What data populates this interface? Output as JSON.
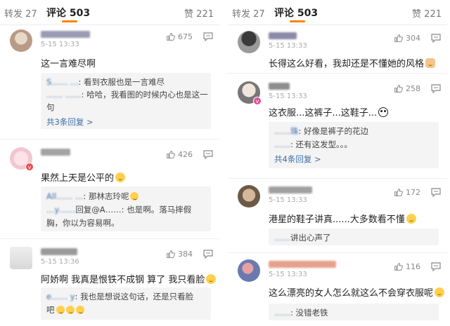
{
  "left": {
    "tabs": {
      "repost": "转发 27",
      "comments": "评论 503",
      "likes": "赞 221"
    },
    "comments": [
      {
        "time": "5-15 13:33",
        "likes": "675",
        "text": "这一言难尽啊",
        "replies": [
          {
            "name": "S…… …",
            "text": ": 看到衣服也是一言难尽"
          },
          {
            "name": "…… ……",
            "text": ": 哈哈，我看图的时候内心也是这一"
          },
          {
            "name": "",
            "text": "句"
          }
        ],
        "more": "共3条回复 >"
      },
      {
        "time": "",
        "likes": "426",
        "text": "果然上天是公平的",
        "replies": [
          {
            "name": "All…… …",
            "text": ": 那林志玲呢"
          },
          {
            "name": "…y……",
            "text": "回复@A……: 也是啊。落马摔假"
          },
          {
            "name": "",
            "text": "胸，你以为容易啊。"
          }
        ],
        "more": ""
      },
      {
        "time": "5-15 13:36",
        "likes": "384",
        "text": "阿娇啊 我真是恨铁不成钢 算了 我只看脸",
        "replies": [
          {
            "name": "e…… y",
            "text": ": 我也是想说这句话，还是只看脸"
          },
          {
            "name": "",
            "text": "吧"
          }
        ],
        "more": ""
      }
    ]
  },
  "right": {
    "tabs": {
      "repost": "转发 27",
      "comments": "评论 503",
      "likes": "赞 221"
    },
    "comments": [
      {
        "time": "5-15 13:33",
        "likes": "304",
        "text": "长得这么好看，我却还是不懂她的风格",
        "replies": [],
        "more": ""
      },
      {
        "time": "5-15 13:33",
        "likes": "258",
        "text": "这衣服...这裤子...这鞋子...",
        "replies": [
          {
            "name": "……珠",
            "text": ": 好像是裤子的花边"
          },
          {
            "name": "……",
            "text": ": 还有这发型。。。"
          }
        ],
        "more": "共4条回复 >"
      },
      {
        "time": "5-15 13:33",
        "likes": "172",
        "text": "港星的鞋子讲真......大多数看不懂",
        "replies": [
          {
            "name": "……",
            "text": "讲出心声了"
          }
        ],
        "more": ""
      },
      {
        "time": "5-15 13:33",
        "likes": "116",
        "text": "这么漂亮的女人怎么就这么不会穿衣服呢",
        "replies": [
          {
            "name": "……",
            "text": ": 没错老铁"
          }
        ],
        "more": ""
      }
    ]
  },
  "colors": {
    "accent": "#ff8200",
    "link": "#3d6ea8",
    "reply_bg": "#f4f4f4",
    "text": "#222222",
    "muted": "#aaaaaa"
  }
}
